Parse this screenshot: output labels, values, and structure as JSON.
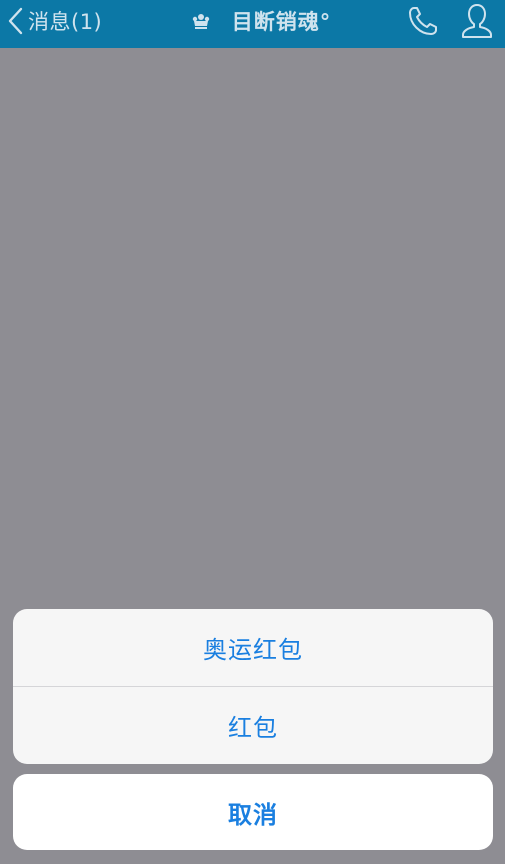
{
  "navbar": {
    "back_label": "消息(1)",
    "title": "目断销魂°",
    "icons": {
      "back": "chevron-left-icon",
      "crown": "crown-icon",
      "phone": "phone-icon",
      "profile": "person-icon"
    },
    "background_color": "#0c78a6"
  },
  "action_sheet": {
    "options": [
      {
        "label": "奥运红包"
      },
      {
        "label": "红包"
      }
    ],
    "cancel_label": "取消",
    "accent_color": "#1a7fe0"
  },
  "overlay_color": "#8e8d93"
}
